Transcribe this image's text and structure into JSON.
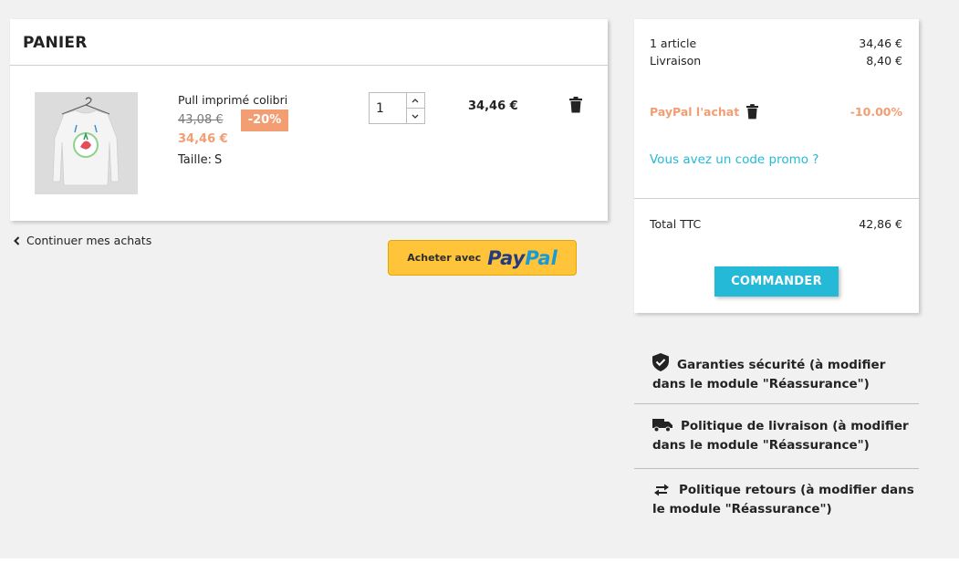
{
  "cart": {
    "title": "PANIER",
    "item": {
      "name": "Pull imprimé colibri",
      "price_old": "43,08 €",
      "discount": "-20%",
      "price_new": "34,46 €",
      "size_label": "Taille:",
      "size_value": "S",
      "quantity": "1",
      "line_total": "34,46 €"
    }
  },
  "continue_link": "Continuer mes achats",
  "paypal_button": {
    "text": "Acheter avec",
    "logo_pay": "Pay",
    "logo_pal": "Pal"
  },
  "summary": {
    "articles_label": "1 article",
    "articles_value": "34,46 €",
    "shipping_label": "Livraison",
    "shipping_value": "8,40 €",
    "paypal_discount_label": "PayPal l'achat",
    "paypal_discount_value": "-10.00%",
    "promo_link": "Vous avez un code promo ?",
    "total_label": "Total TTC",
    "total_value": "42,86 €",
    "order_button": "COMMANDER"
  },
  "reassurance": [
    {
      "text": "Garanties sécurité (à modifier dans le module \"Réassurance\")",
      "icon": "shield-check-icon"
    },
    {
      "text": "Politique de livraison (à modifier dans le module \"Réassurance\")",
      "icon": "truck-icon"
    },
    {
      "text": "Politique retours (à modifier dans le module \"Réassurance\")",
      "icon": "swap-arrows-icon"
    }
  ],
  "colors": {
    "accent": "#24b9d7",
    "discount": "#f39d72",
    "paypal_yellow": "#ffc439"
  }
}
